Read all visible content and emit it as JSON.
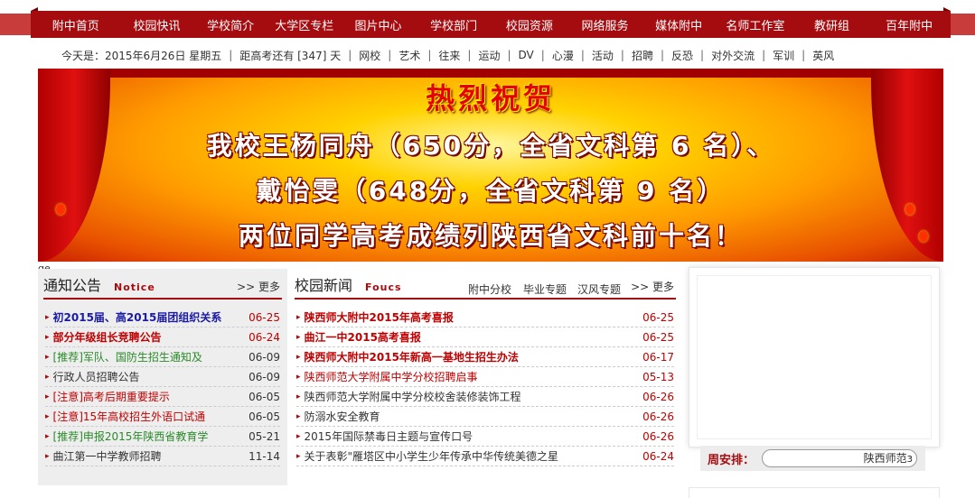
{
  "nav": {
    "items": [
      "附中首页",
      "校园快讯",
      "学校简介",
      "大学区专栏",
      "图片中心",
      "学校部门",
      "校园资源",
      "网络服务",
      "媒体附中",
      "名师工作室",
      "教研组",
      "百年附中"
    ]
  },
  "datebar": {
    "today": "今天是：2015年6月26日 星期五",
    "countdown": "距高考还有 [347] 天",
    "links": [
      "网校",
      "艺术",
      "往来",
      "运动",
      "DV",
      "心漫",
      "活动",
      "招聘",
      "反恐",
      "对外交流",
      "军训",
      "英风"
    ]
  },
  "banner": {
    "title": "热烈祝贺",
    "line1": "我校王杨同舟（650分，全省文科第 6 名）、",
    "line2": "戴怡雯（648分，全省文科第 9 名）",
    "line3": "两位同学高考成绩列陕西省文科前十名！"
  },
  "stray_text": "ge",
  "notice": {
    "title": "通知公告",
    "en": "Notice",
    "more": ">> 更多",
    "items": [
      {
        "text": "初2015届、高2015届团组织关系",
        "date": "06-25",
        "color": "#1a1aa6",
        "bold": true
      },
      {
        "text": "部分年级组长竞聘公告",
        "date": "06-24",
        "color": "#c00000",
        "bold": true
      },
      {
        "text": "[推荐]军队、国防生招生通知及",
        "date": "06-09",
        "color": "#2a8a2a",
        "bold": false
      },
      {
        "text": "行政人员招聘公告",
        "date": "06-09",
        "color": "#333333",
        "bold": false
      },
      {
        "text": "[注意]高考后期重要提示",
        "date": "06-05",
        "color": "#c00000",
        "bold": false
      },
      {
        "text": "[注意]15年高校招生外语口试通",
        "date": "06-05",
        "color": "#c00000",
        "bold": false
      },
      {
        "text": "[推荐]申报2015年陕西省教育学",
        "date": "05-21",
        "color": "#2a8a2a",
        "bold": false
      },
      {
        "text": "曲江第一中学教师招聘",
        "date": "11-14",
        "color": "#333333",
        "bold": false
      }
    ]
  },
  "news": {
    "title": "校园新闻",
    "en": "Foucs",
    "tabs": [
      "附中分校",
      "毕业专题",
      "汉风专题"
    ],
    "more": ">> 更多",
    "items": [
      {
        "text": "陕西师大附中2015年高考喜报",
        "date": "06-25",
        "color": "#c00000",
        "bold": true
      },
      {
        "text": "曲江一中2015高考喜报",
        "date": "06-25",
        "color": "#c00000",
        "bold": true
      },
      {
        "text": "陕西师大附中2015年新高一基地生招生办法",
        "date": "06-17",
        "color": "#c00000",
        "bold": true
      },
      {
        "text": "陕西师范大学附属中学分校招聘启事",
        "date": "05-13",
        "color": "#c00000",
        "bold": false
      },
      {
        "text": "陕西师范大学附属中学分校校舍装修装饰工程",
        "date": "06-26",
        "color": "#333333",
        "bold": false
      },
      {
        "text": "防溺水安全教育",
        "date": "06-26",
        "color": "#333333",
        "bold": false
      },
      {
        "text": "2015年国际禁毒日主题与宣传口号",
        "date": "06-26",
        "color": "#333333",
        "bold": false
      },
      {
        "text": "关于表彰\"雁塔区中小学生少年传承中华传统美德之星",
        "date": "06-24",
        "color": "#333333",
        "bold": false
      }
    ]
  },
  "zhouanpai": {
    "label": "周安排：",
    "select_value": "陕西师范з"
  },
  "colors": {
    "brand": "#a50c10",
    "date_red": "#c00000"
  }
}
